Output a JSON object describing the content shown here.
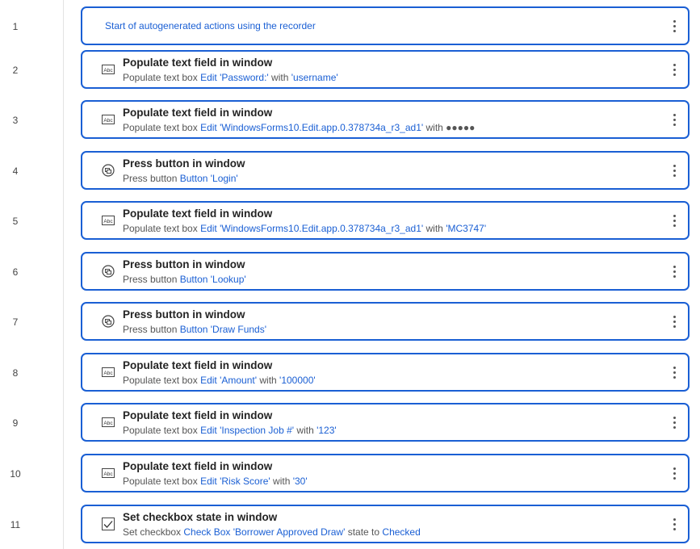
{
  "steps": [
    {
      "num": "1",
      "type": "comment",
      "text": "Start of autogenerated actions using the recorder"
    },
    {
      "num": "2",
      "type": "text",
      "icon": "abc-textbox-icon",
      "title": "Populate text field in window",
      "parts": [
        {
          "t": "Populate text box "
        },
        {
          "t": "Edit 'Password:'",
          "link": true
        },
        {
          "t": " with "
        },
        {
          "t": "'username'",
          "link": true
        }
      ]
    },
    {
      "num": "3",
      "type": "text",
      "icon": "abc-textbox-icon",
      "title": "Populate text field in window",
      "parts": [
        {
          "t": "Populate text box "
        },
        {
          "t": "Edit 'WindowsForms10.Edit.app.0.378734a_r3_ad1'",
          "link": true
        },
        {
          "t": " with ●●●●●"
        }
      ]
    },
    {
      "num": "4",
      "type": "button",
      "icon": "press-button-icon",
      "title": "Press button in window",
      "parts": [
        {
          "t": "Press button "
        },
        {
          "t": "Button 'Login'",
          "link": true
        }
      ]
    },
    {
      "num": "5",
      "type": "text",
      "icon": "abc-textbox-icon",
      "title": "Populate text field in window",
      "parts": [
        {
          "t": "Populate text box "
        },
        {
          "t": "Edit 'WindowsForms10.Edit.app.0.378734a_r3_ad1'",
          "link": true
        },
        {
          "t": " with "
        },
        {
          "t": "'MC3747'",
          "link": true
        }
      ]
    },
    {
      "num": "6",
      "type": "button",
      "icon": "press-button-icon",
      "title": "Press button in window",
      "parts": [
        {
          "t": "Press button "
        },
        {
          "t": "Button 'Lookup'",
          "link": true
        }
      ]
    },
    {
      "num": "7",
      "type": "button",
      "icon": "press-button-icon",
      "title": "Press button in window",
      "parts": [
        {
          "t": "Press button "
        },
        {
          "t": "Button 'Draw Funds'",
          "link": true
        }
      ]
    },
    {
      "num": "8",
      "type": "text",
      "icon": "abc-textbox-icon",
      "title": "Populate text field in window",
      "parts": [
        {
          "t": "Populate text box "
        },
        {
          "t": "Edit 'Amount'",
          "link": true
        },
        {
          "t": " with "
        },
        {
          "t": "'100000'",
          "link": true
        }
      ]
    },
    {
      "num": "9",
      "type": "text",
      "icon": "abc-textbox-icon",
      "title": "Populate text field in window",
      "parts": [
        {
          "t": "Populate text box "
        },
        {
          "t": "Edit 'Inspection Job #'",
          "link": true
        },
        {
          "t": " with "
        },
        {
          "t": "'123'",
          "link": true
        }
      ]
    },
    {
      "num": "10",
      "type": "text",
      "icon": "abc-textbox-icon",
      "title": "Populate text field in window",
      "parts": [
        {
          "t": "Populate text box "
        },
        {
          "t": "Edit 'Risk Score'",
          "link": true
        },
        {
          "t": " with "
        },
        {
          "t": "'30'",
          "link": true
        }
      ]
    },
    {
      "num": "11",
      "type": "checkbox",
      "icon": "checkbox-checked-icon",
      "title": "Set checkbox state in window",
      "parts": [
        {
          "t": "Set checkbox "
        },
        {
          "t": "Check Box 'Borrower Approved Draw'",
          "link": true
        },
        {
          "t": " state to "
        },
        {
          "t": "Checked",
          "link": true
        }
      ]
    }
  ],
  "colors": {
    "accent": "#1a5fd4"
  }
}
